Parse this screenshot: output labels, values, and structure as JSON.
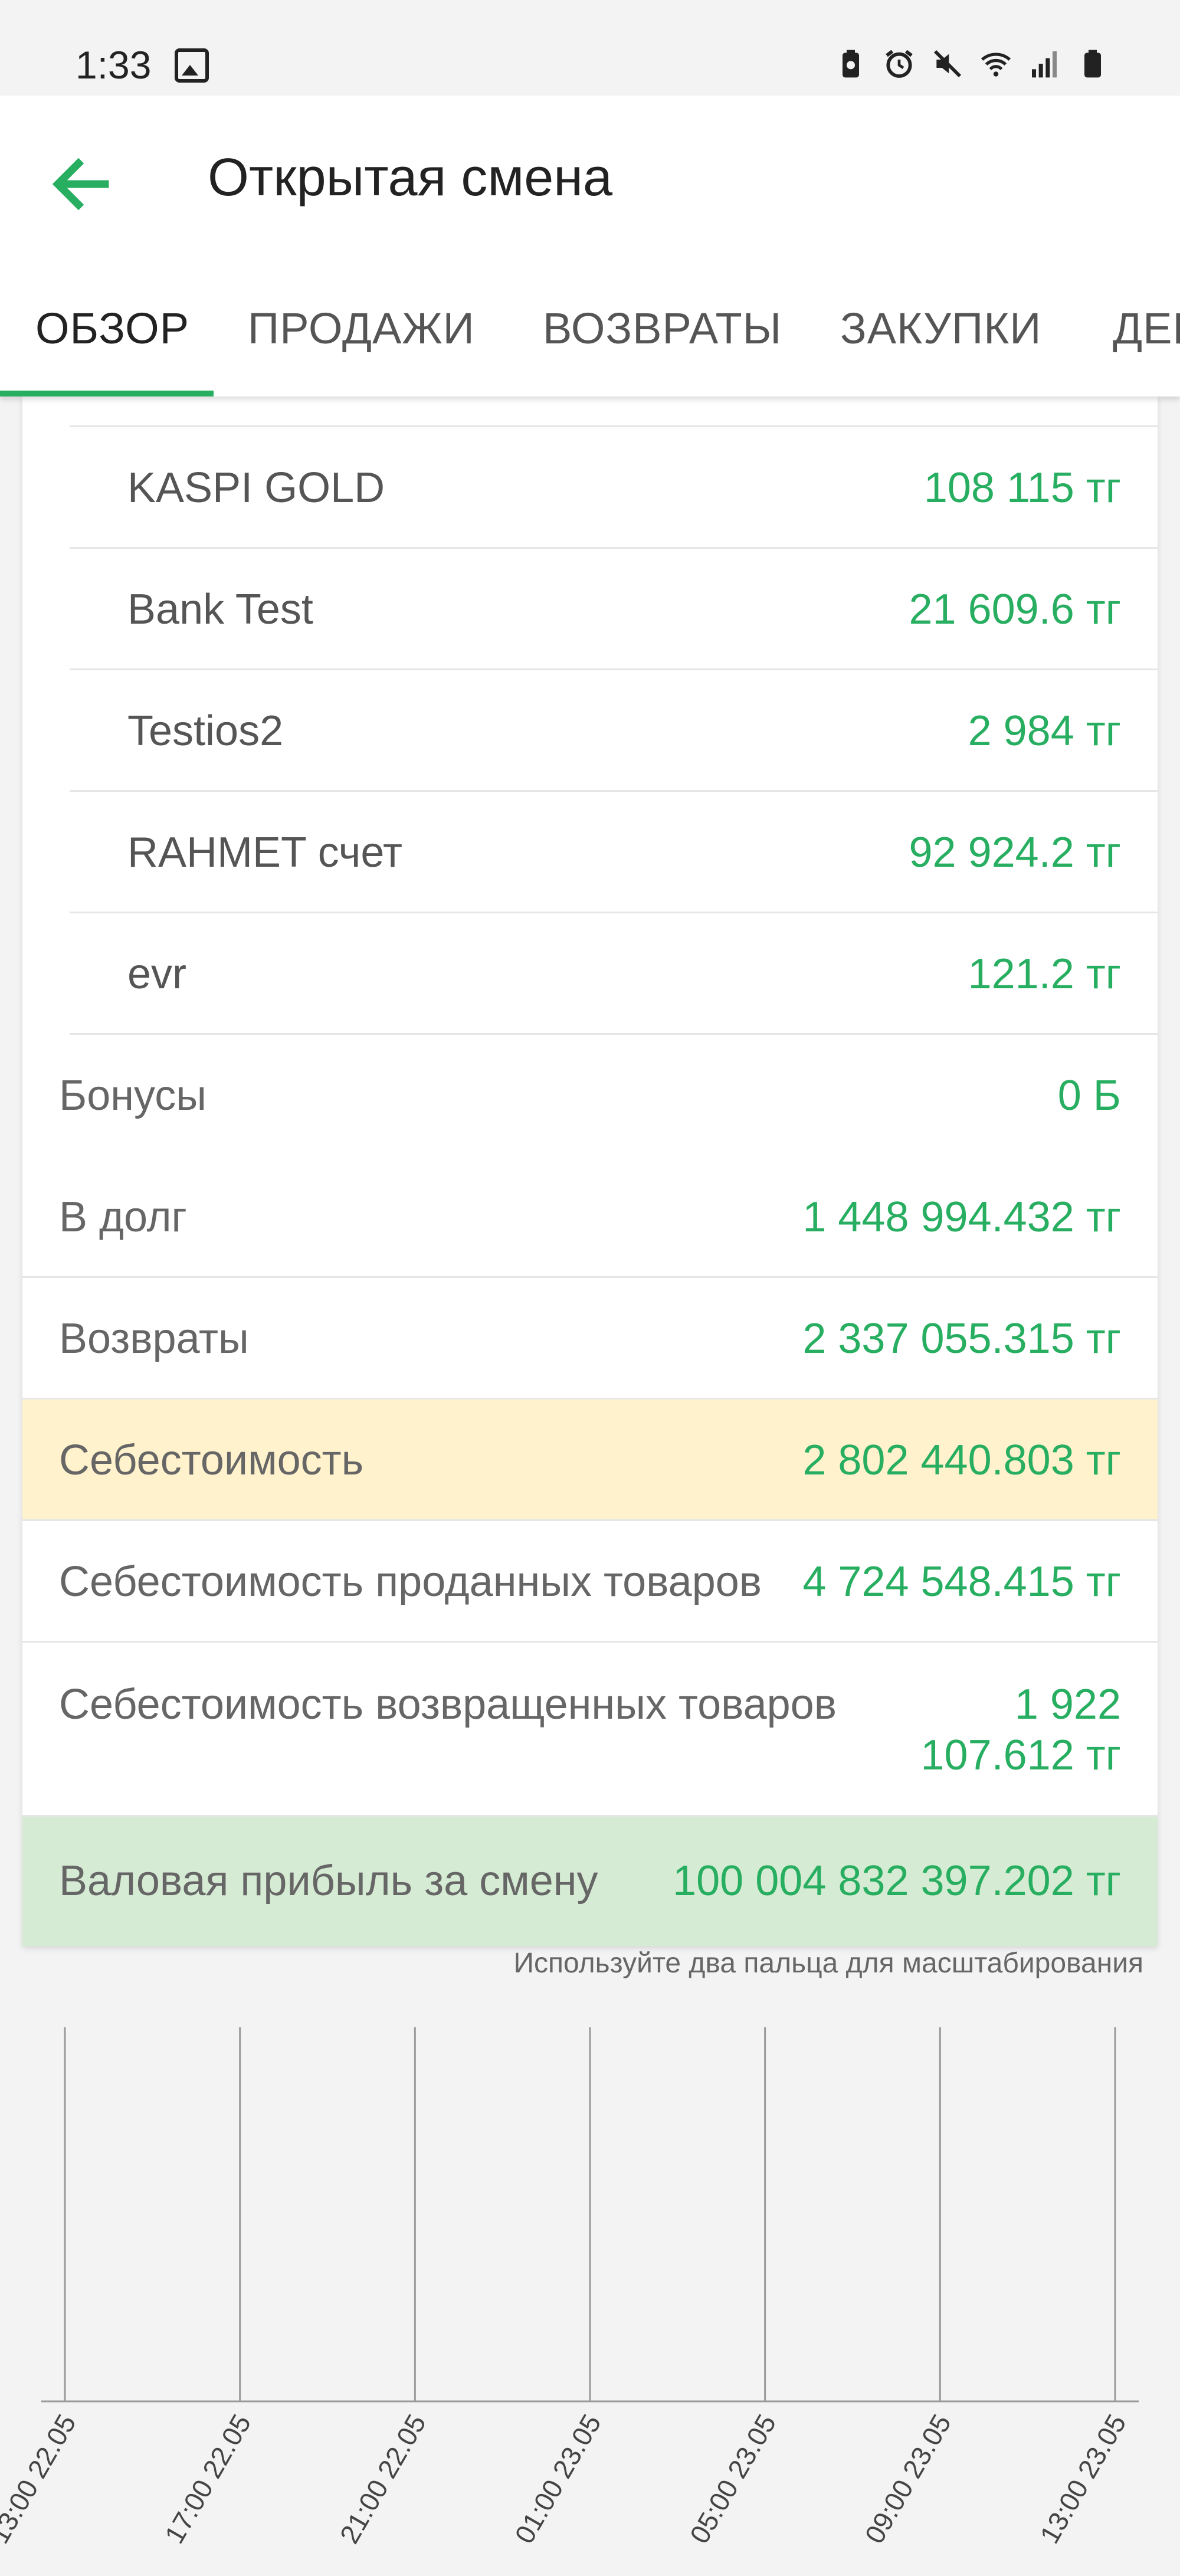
{
  "status_bar": {
    "time": "1:33"
  },
  "app_bar": {
    "title": "Открытая смена"
  },
  "tabs": [
    "ОБЗОР",
    "ПРОДАЖИ",
    "ВОЗВРАТЫ",
    "ЗАКУПКИ",
    "ДЕН"
  ],
  "payment_methods": [
    {
      "label": "KASPI GOLD",
      "value": "108 115 тг"
    },
    {
      "label": "Bank Test",
      "value": "21 609.6 тг"
    },
    {
      "label": "Testios2",
      "value": "2 984 тг"
    },
    {
      "label": "RAHMET счет",
      "value": "92 924.2 тг"
    },
    {
      "label": "evr",
      "value": "121.2 тг"
    }
  ],
  "summary": {
    "bonuses": {
      "label": "Бонусы",
      "value": "0 Б"
    },
    "debt": {
      "label": "В долг",
      "value": "1 448 994.432 тг"
    },
    "returns": {
      "label": "Возвраты",
      "value": "2 337 055.315 тг"
    },
    "cost": {
      "label": "Себестоимость",
      "value": "2 802 440.803 тг"
    },
    "cost_sold": {
      "label": "Себестоимость проданных товаров",
      "value": "4 724 548.415 тг"
    },
    "cost_returned": {
      "label": "Себестоимость возвращенных товаров",
      "value_line1": "1 922",
      "value_line2": "107.612 тг"
    },
    "gross_profit": {
      "label": "Валовая прибыль за смену",
      "value": "100 004 832 397.202 тг"
    }
  },
  "zoom_hint": "Используйте два пальца для масштабирования",
  "colors": {
    "accent": "#27ae60",
    "highlight_yellow": "#fff2cc",
    "highlight_green": "#d6ebd3"
  },
  "chart_data": {
    "type": "line",
    "x": [
      "13:00 22.05",
      "17:00 22.05",
      "21:00 22.05",
      "01:00 23.05",
      "05:00 23.05",
      "09:00 23.05",
      "13:00 23.05"
    ],
    "series": [],
    "grid": true
  }
}
